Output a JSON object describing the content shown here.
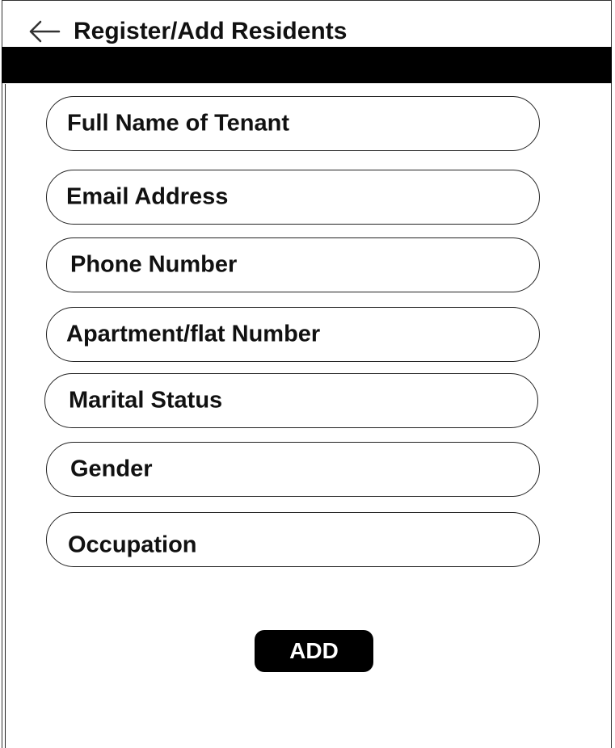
{
  "header": {
    "title": "Register/Add Residents",
    "back_icon": "arrow-left-icon"
  },
  "form": {
    "fields": [
      {
        "label": "Full Name of Tenant"
      },
      {
        "label": "Email Address"
      },
      {
        "label": "Phone Number"
      },
      {
        "label": "Apartment/flat Number"
      },
      {
        "label": "Marital Status"
      },
      {
        "label": "Gender"
      },
      {
        "label": "Occupation"
      }
    ],
    "submit_label": "ADD"
  },
  "colors": {
    "accent_bar": "#000000",
    "button_bg": "#000000",
    "button_text": "#ffffff"
  }
}
